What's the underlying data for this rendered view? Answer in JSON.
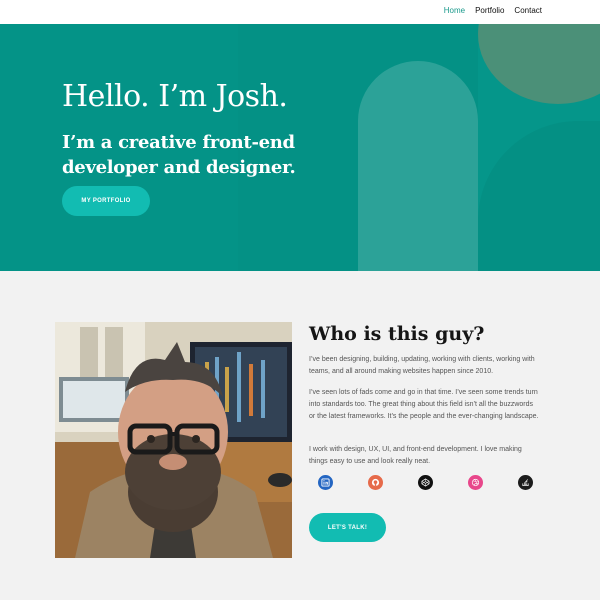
{
  "nav": {
    "items": [
      {
        "label": "Home",
        "active": true
      },
      {
        "label": "Portfolio",
        "active": false
      },
      {
        "label": "Contact",
        "active": false
      }
    ]
  },
  "hero": {
    "title": "Hello. I’m Josh.",
    "subtitle": "I’m a creative front-end developer and designer.",
    "button_label": "MY PORTFOLIO",
    "background_color": "#05968a",
    "accent_color": "#12bcb2"
  },
  "about": {
    "title": "Who is this guy?",
    "paragraphs": [
      "I’ve been designing, building, updating, working with clients, working with teams, and all around making websites happen since 2010.",
      "I’ve seen lots of fads come and go in that time. I’ve seen some trends turn into standards too. The great thing about this field isn’t all the buzzwords or the latest frameworks. It’s the people and the ever-changing landscape.",
      "I work with design, UX, UI, and front-end development. I love making things easy to use and look really neat."
    ],
    "socials": [
      {
        "icon": "linkedin-icon",
        "color": "#2466c2"
      },
      {
        "icon": "github-icon",
        "color": "#e66a4a"
      },
      {
        "icon": "codepen-icon",
        "color": "#111111"
      },
      {
        "icon": "dribbble-icon",
        "color": "#e8478b"
      },
      {
        "icon": "stackoverflow-icon",
        "color": "#1c1c1c"
      }
    ],
    "button_label": "LET'S TALK!"
  }
}
